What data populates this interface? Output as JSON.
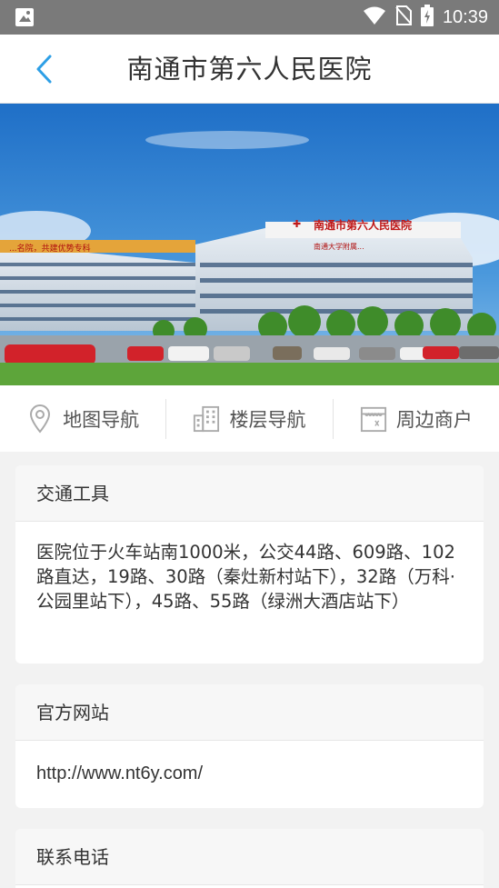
{
  "status_bar": {
    "time": "10:39",
    "icons": [
      "notification-image-icon",
      "wifi-icon",
      "no-sim-icon",
      "battery-charging-icon"
    ]
  },
  "header": {
    "back_icon": "chevron-left-icon",
    "title": "南通市第六人民医院"
  },
  "banner": {
    "signage": {
      "main": "南通市第六人民医院",
      "sub": "南通大学附属...",
      "left_banner": "...名院，共建优势专科"
    }
  },
  "nav": {
    "items": [
      {
        "icon": "map-pin-icon",
        "label": "地图导航"
      },
      {
        "icon": "building-icon",
        "label": "楼层导航"
      },
      {
        "icon": "shop-icon",
        "label": "周边商户"
      }
    ]
  },
  "cards": {
    "transport": {
      "title": "交通工具",
      "content": "医院位于火车站南1000米，公交44路、609路、102路直达，19路、30路（秦灶新村站下），32路（万科·公园里站下），45路、55路（绿洲大酒店站下）"
    },
    "website": {
      "title": "官方网站",
      "content": "http://www.nt6y.com/"
    },
    "phone": {
      "title": "联系电话"
    }
  },
  "colors": {
    "status_bar": "#7a7a7a",
    "accent_blue": "#2d9fe6",
    "icon_gray": "#aaaaaa",
    "page_bg": "#f2f2f2"
  }
}
